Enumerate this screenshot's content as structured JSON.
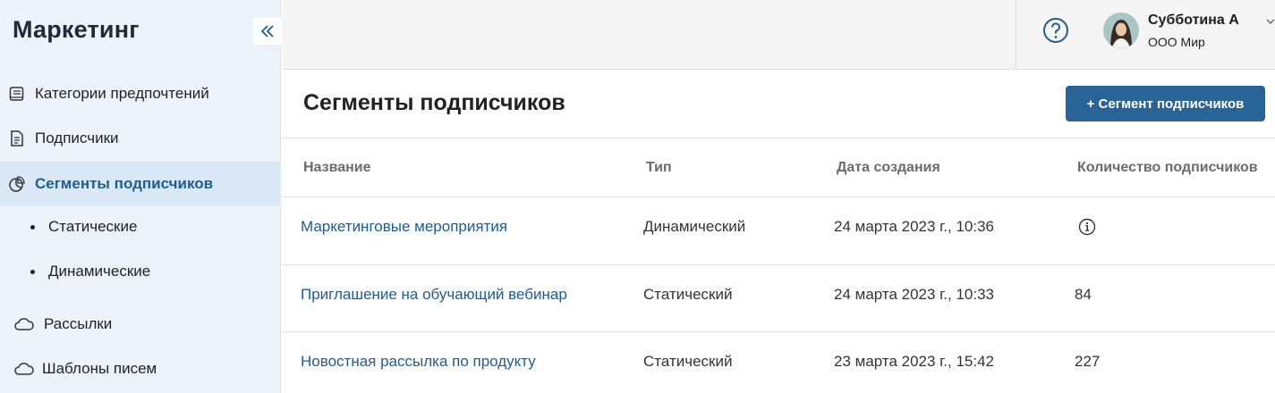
{
  "sidebar": {
    "app_title": "Маркетинг",
    "items": [
      {
        "label": "Категории предпочтений",
        "icon": "book-icon"
      },
      {
        "label": "Подписчики",
        "icon": "document-icon"
      },
      {
        "label": "Сегменты подписчиков",
        "icon": "pie-chart-icon",
        "active": true
      },
      {
        "label": "Статические"
      },
      {
        "label": "Динамические"
      },
      {
        "label": "Рассылки",
        "icon": "cloud-icon"
      },
      {
        "label": "Шаблоны писем",
        "icon": "cloud-icon"
      }
    ]
  },
  "header": {
    "user": {
      "name": "Субботина А",
      "org": "ООО Мир"
    },
    "help_icon": "help-icon"
  },
  "main": {
    "title": "Сегменты подписчиков",
    "add_button_label": "+ Сегмент подписчиков",
    "table": {
      "columns": [
        "Название",
        "Тип",
        "Дата создания",
        "Количество подписчиков"
      ],
      "rows": [
        {
          "name": "Маркетинговые мероприятия",
          "type": "Динамический",
          "created": "24 марта 2023 г., 10:36",
          "count": "",
          "count_icon": "info-icon"
        },
        {
          "name": "Приглашение на обучающий вебинар",
          "type": "Статический",
          "created": "24 марта 2023 г., 10:33",
          "count": "84"
        },
        {
          "name": "Новостная рассылка по продукту",
          "type": "Статический",
          "created": "23 марта 2023 г., 15:42",
          "count": "227"
        }
      ]
    }
  },
  "colors": {
    "accent": "#235b8d",
    "button": "#2a6496",
    "sidebar_bg": "#edf3fa",
    "active_bg": "#dae7f4"
  }
}
